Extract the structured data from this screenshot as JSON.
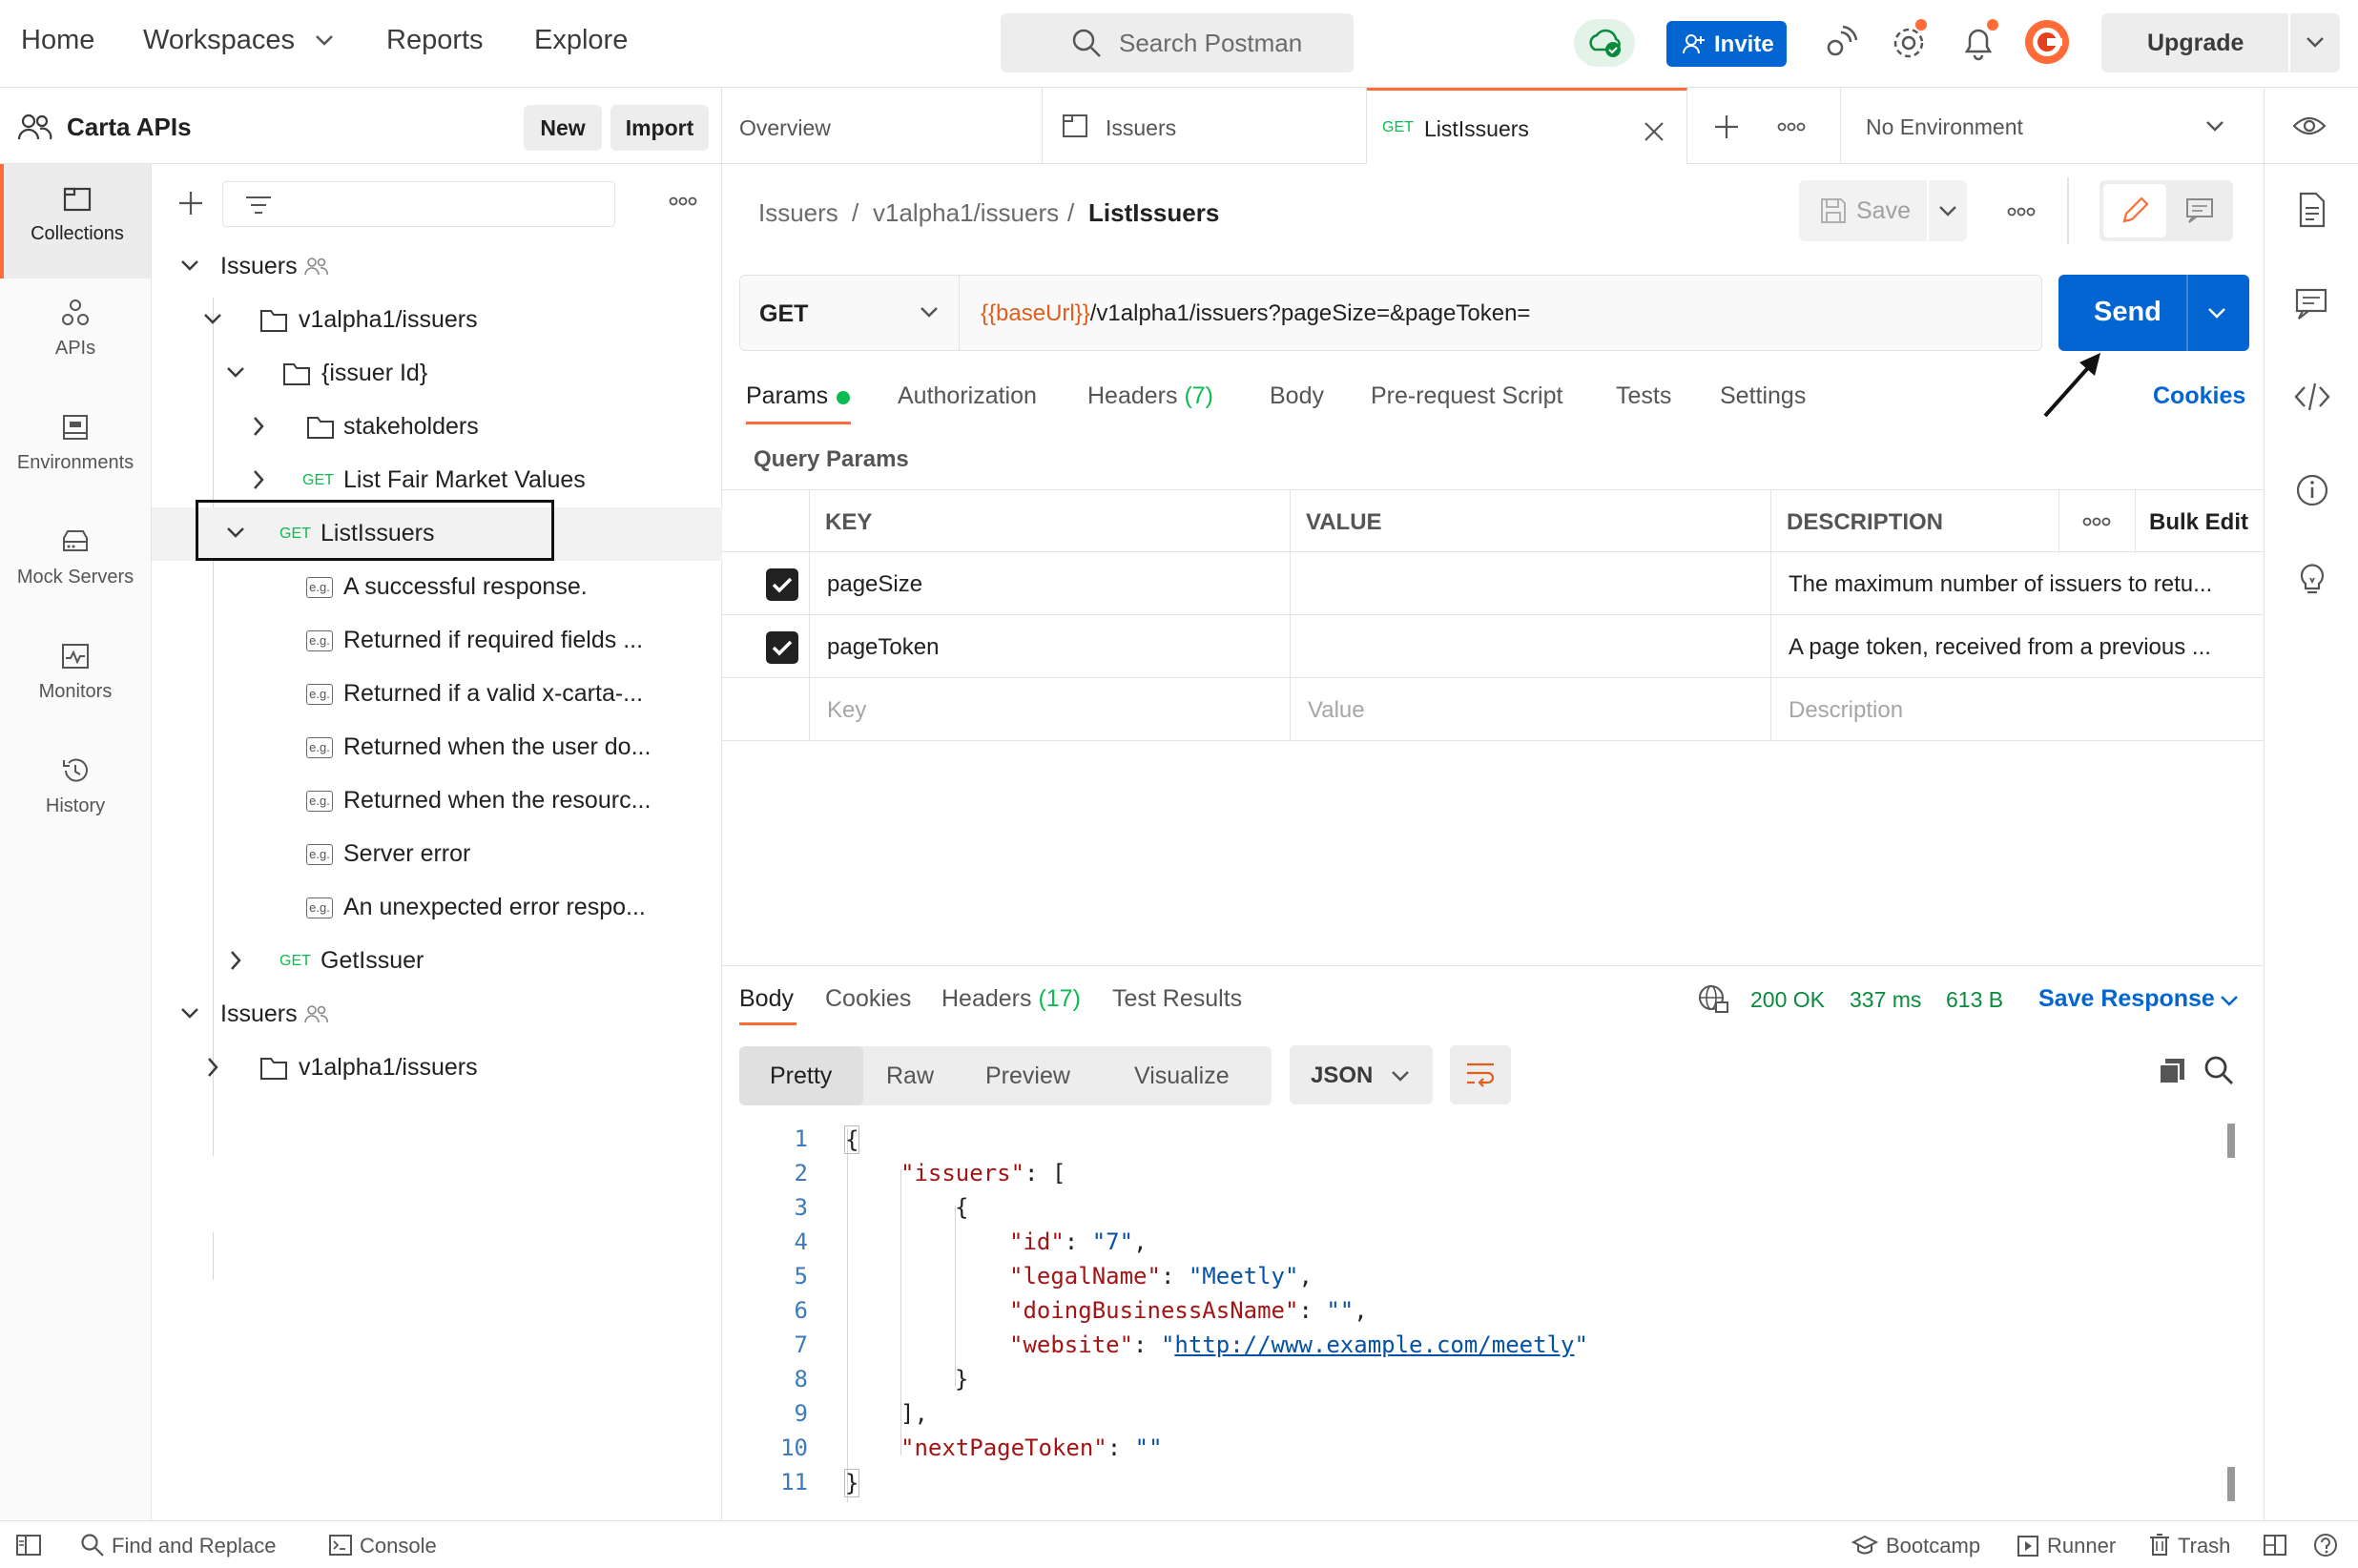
{
  "topbar": {
    "nav": [
      "Home",
      "Workspaces",
      "Reports",
      "Explore"
    ],
    "search_placeholder": "Search Postman",
    "invite_label": "Invite",
    "upgrade_label": "Upgrade"
  },
  "workspace": {
    "title": "Carta APIs",
    "new_label": "New",
    "import_label": "Import"
  },
  "rail": {
    "items": [
      {
        "label": "Collections",
        "icon": "collections-icon"
      },
      {
        "label": "APIs",
        "icon": "apis-icon"
      },
      {
        "label": "Environments",
        "icon": "environments-icon"
      },
      {
        "label": "Mock Servers",
        "icon": "mock-servers-icon"
      },
      {
        "label": "Monitors",
        "icon": "monitors-icon"
      },
      {
        "label": "History",
        "icon": "history-icon"
      }
    ]
  },
  "tree": {
    "items": [
      {
        "label": "Issuers"
      },
      {
        "label": "v1alpha1/issuers"
      },
      {
        "label": "{issuer Id}"
      },
      {
        "label": "stakeholders"
      },
      {
        "label": "List Fair Market Values",
        "method": "GET"
      },
      {
        "label": "ListIssuers",
        "method": "GET"
      },
      {
        "label": "A successful response."
      },
      {
        "label": "Returned if required fields ..."
      },
      {
        "label": "Returned if a valid x-carta-..."
      },
      {
        "label": "Returned when the user do..."
      },
      {
        "label": "Returned when the resourc..."
      },
      {
        "label": "Server error"
      },
      {
        "label": "An unexpected error respo..."
      },
      {
        "label": "GetIssuer",
        "method": "GET"
      },
      {
        "label": "Issuers"
      },
      {
        "label": "v1alpha1/issuers"
      }
    ],
    "example_badge": "e.g."
  },
  "tabs": {
    "items": [
      {
        "label": "Overview"
      },
      {
        "label": "Issuers"
      },
      {
        "label": "ListIssuers",
        "method": "GET"
      }
    ],
    "environment": "No Environment"
  },
  "breadcrumb": {
    "parts": [
      "Issuers",
      "v1alpha1/issuers",
      "ListIssuers"
    ],
    "separator": "/",
    "save_label": "Save"
  },
  "request": {
    "method": "GET",
    "url_var": "{{baseUrl}}",
    "url_rest": "/v1alpha1/issuers?pageSize=&pageToken=",
    "send_label": "Send",
    "tabs": [
      "Params",
      "Authorization",
      "Headers",
      "Body",
      "Pre-request Script",
      "Tests",
      "Settings"
    ],
    "headers_count": "(7)",
    "cookies_label": "Cookies",
    "query_params_title": "Query Params"
  },
  "params": {
    "columns": [
      "KEY",
      "VALUE",
      "DESCRIPTION"
    ],
    "bulk_edit": "Bulk Edit",
    "rows": [
      {
        "key": "pageSize",
        "value": "",
        "description": "The maximum number of issuers to retu..."
      },
      {
        "key": "pageToken",
        "value": "",
        "description": "A page token, received from a previous ..."
      }
    ],
    "placeholders": {
      "key": "Key",
      "value": "Value",
      "description": "Description"
    }
  },
  "response": {
    "tabs": [
      "Body",
      "Cookies",
      "Headers",
      "Test Results"
    ],
    "headers_count": "(17)",
    "status": "200 OK",
    "time": "337 ms",
    "size": "613 B",
    "save_response": "Save Response",
    "formats": [
      "Pretty",
      "Raw",
      "Preview",
      "Visualize"
    ],
    "language": "JSON",
    "line_numbers": [
      "1",
      "2",
      "3",
      "4",
      "5",
      "6",
      "7",
      "8",
      "9",
      "10",
      "11"
    ],
    "code": {
      "k_issuers": "\"issuers\"",
      "k_id": "\"id\"",
      "v_id": "\"7\"",
      "k_legalName": "\"legalName\"",
      "v_legalName": "\"Meetly\"",
      "k_dba": "\"doingBusinessAsName\"",
      "v_dba": "\"\"",
      "k_website": "\"website\"",
      "v_website": "http://www.example.com/meetly",
      "k_next": "\"nextPageToken\"",
      "v_next": "\"\""
    }
  },
  "status_bar": {
    "find_replace": "Find and Replace",
    "console": "Console",
    "bootcamp": "Bootcamp",
    "runner": "Runner",
    "trash": "Trash"
  },
  "colors": {
    "accent_orange": "#ff6c37",
    "send_blue": "#0265d2",
    "get_green": "#0cbb52"
  }
}
